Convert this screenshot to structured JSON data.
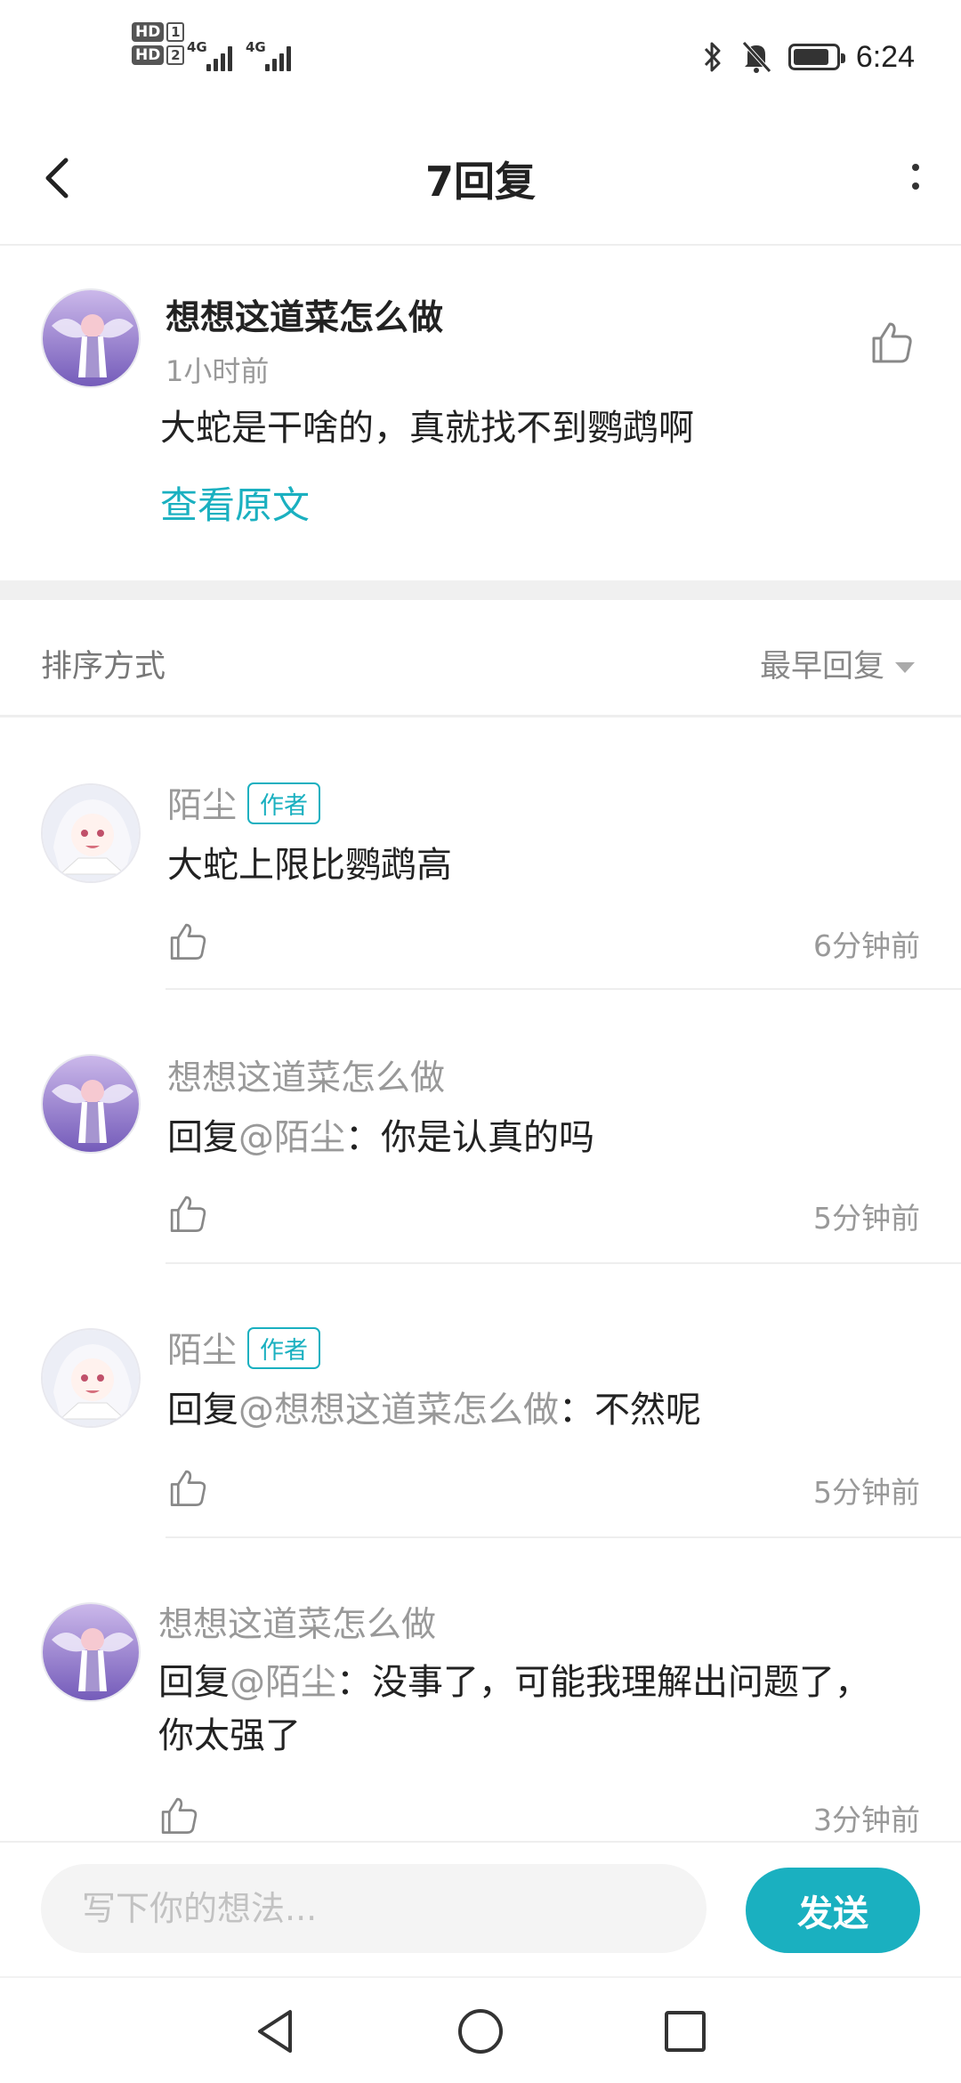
{
  "status_bar": {
    "sim1_hd": "HD",
    "sim1_num": "1",
    "sim2_hd": "HD",
    "sim2_num": "2",
    "net1": "4G",
    "net2": "4G",
    "time": "6:24",
    "battery_level": 0.85
  },
  "header": {
    "title": "7回复"
  },
  "original_comment": {
    "author": "想想这道菜怎么做",
    "time": "1小时前",
    "content": "大蛇是干啥的，真就找不到鹦鹉啊",
    "view_original": "查看原文"
  },
  "sort": {
    "label": "排序方式",
    "selected": "最早回复"
  },
  "replies": [
    {
      "author": "陌尘",
      "badge": "作者",
      "prefix": "",
      "mention": "",
      "content": "大蛇上限比鹦鹉高",
      "time": "6分钟前"
    },
    {
      "author": "想想这道菜怎么做",
      "badge": "",
      "prefix": "回复",
      "mention": "@陌尘",
      "content": "：你是认真的吗",
      "time": "5分钟前"
    },
    {
      "author": "陌尘",
      "badge": "作者",
      "prefix": "回复",
      "mention": "@想想这道菜怎么做",
      "content": "：不然呢",
      "time": "5分钟前"
    },
    {
      "author": "想想这道菜怎么做",
      "badge": "",
      "prefix": "回复",
      "mention": "@陌尘",
      "content": "：没事了，可能我理解出问题了，",
      "content_line2": "你太强了",
      "time": "3分钟前"
    }
  ],
  "input": {
    "placeholder": "写下你的想法...",
    "send_label": "发送"
  },
  "colors": {
    "accent": "#1ab0c0",
    "muted_text": "#999999",
    "divider": "#eeeeee"
  }
}
